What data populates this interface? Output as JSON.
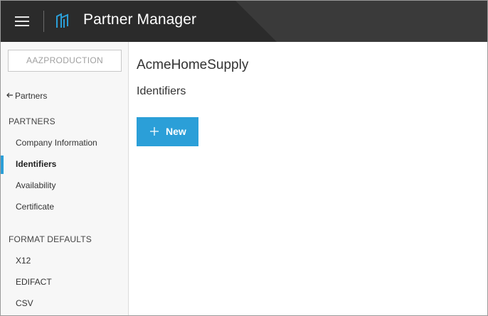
{
  "header": {
    "app_title": "Partner Manager",
    "menu_icon": "hamburger-menu-icon",
    "logo_icon": "partner-manager-logo-icon"
  },
  "sidebar": {
    "environment": "AAZPRODUCTION",
    "back_link": "Partners",
    "sections": [
      {
        "title": "PARTNERS",
        "items": [
          {
            "label": "Company Information",
            "active": false
          },
          {
            "label": "Identifiers",
            "active": true
          },
          {
            "label": "Availability",
            "active": false
          },
          {
            "label": "Certificate",
            "active": false
          }
        ]
      },
      {
        "title": "FORMAT DEFAULTS",
        "items": [
          {
            "label": "X12",
            "active": false
          },
          {
            "label": "EDIFACT",
            "active": false
          },
          {
            "label": "CSV",
            "active": false
          }
        ]
      }
    ]
  },
  "main": {
    "partner_name": "AcmeHomeSupply",
    "page_title": "Identifiers",
    "new_button_label": "New"
  },
  "colors": {
    "header_bg": "#2b2b2b",
    "accent": "#2b9fd8",
    "sidebar_bg": "#f7f7f7"
  }
}
